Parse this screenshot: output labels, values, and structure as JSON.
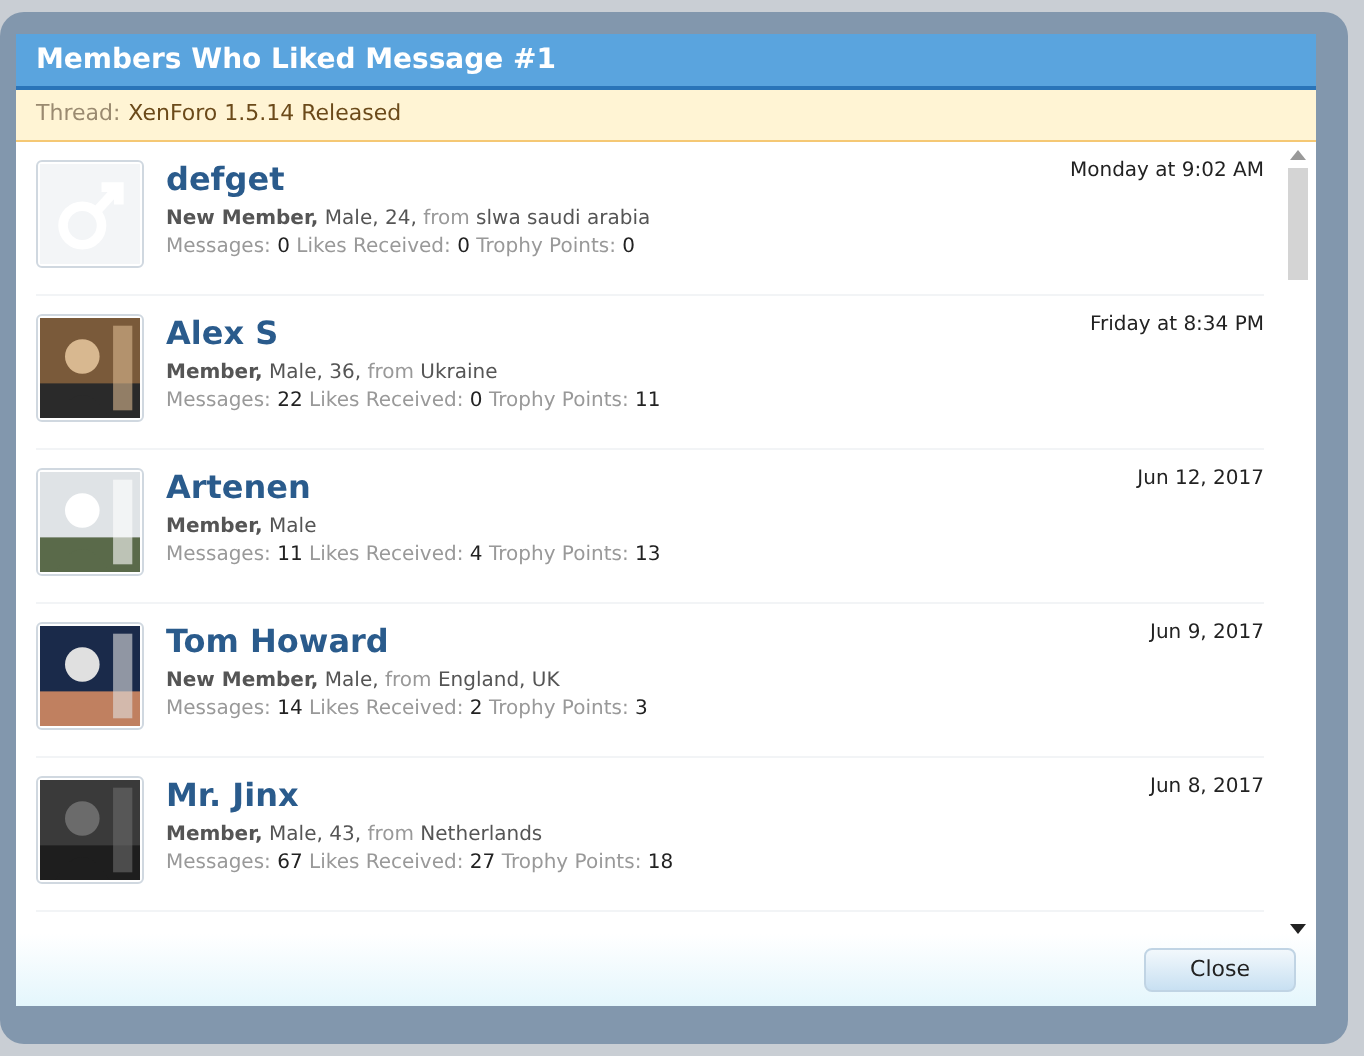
{
  "dialog": {
    "title": "Members Who Liked Message #1",
    "thread": {
      "label": "Thread:",
      "value": "XenForo 1.5.14 Released"
    },
    "members": [
      {
        "avatar": {
          "kind": "default"
        },
        "name": "defget",
        "date": "Monday at 9:02 AM",
        "info": [
          {
            "kind": "role",
            "text": "New Member,"
          },
          {
            "kind": "plain",
            "text": "Male,"
          },
          {
            "kind": "plain",
            "text": "24,"
          },
          {
            "kind": "muted",
            "text": "from"
          },
          {
            "kind": "plain",
            "text": "slwa saudi arabia"
          }
        ],
        "stats": [
          {
            "label": "Messages:",
            "value": "0"
          },
          {
            "label": "Likes Received:",
            "value": "0"
          },
          {
            "label": "Trophy Points:",
            "value": "0"
          }
        ]
      },
      {
        "avatar": {
          "kind": "picture"
        },
        "name": "Alex S",
        "date": "Friday at 8:34 PM",
        "info": [
          {
            "kind": "role",
            "text": "Member,"
          },
          {
            "kind": "plain",
            "text": "Male,"
          },
          {
            "kind": "plain",
            "text": "36,"
          },
          {
            "kind": "muted",
            "text": "from"
          },
          {
            "kind": "plain",
            "text": "Ukraine"
          }
        ],
        "stats": [
          {
            "label": "Messages:",
            "value": "22"
          },
          {
            "label": "Likes Received:",
            "value": "0"
          },
          {
            "label": "Trophy Points:",
            "value": "11"
          }
        ]
      },
      {
        "avatar": {
          "kind": "picture"
        },
        "name": "Artenen",
        "date": "Jun 12, 2017",
        "info": [
          {
            "kind": "role",
            "text": "Member,"
          },
          {
            "kind": "plain",
            "text": "Male"
          }
        ],
        "stats": [
          {
            "label": "Messages:",
            "value": "11"
          },
          {
            "label": "Likes Received:",
            "value": "4"
          },
          {
            "label": "Trophy Points:",
            "value": "13"
          }
        ]
      },
      {
        "avatar": {
          "kind": "picture"
        },
        "name": "Tom Howard",
        "date": "Jun 9, 2017",
        "info": [
          {
            "kind": "role",
            "text": "New Member,"
          },
          {
            "kind": "plain",
            "text": "Male,"
          },
          {
            "kind": "muted",
            "text": "from"
          },
          {
            "kind": "plain",
            "text": "England, UK"
          }
        ],
        "stats": [
          {
            "label": "Messages:",
            "value": "14"
          },
          {
            "label": "Likes Received:",
            "value": "2"
          },
          {
            "label": "Trophy Points:",
            "value": "3"
          }
        ]
      },
      {
        "avatar": {
          "kind": "picture"
        },
        "name": "Mr. Jinx",
        "date": "Jun 8, 2017",
        "info": [
          {
            "kind": "role",
            "text": "Member,"
          },
          {
            "kind": "plain",
            "text": "Male,"
          },
          {
            "kind": "plain",
            "text": "43,"
          },
          {
            "kind": "muted",
            "text": "from"
          },
          {
            "kind": "plain",
            "text": "Netherlands"
          }
        ],
        "stats": [
          {
            "label": "Messages:",
            "value": "67"
          },
          {
            "label": "Likes Received:",
            "value": "27"
          },
          {
            "label": "Trophy Points:",
            "value": "18"
          }
        ]
      }
    ],
    "close_button": "Close"
  }
}
